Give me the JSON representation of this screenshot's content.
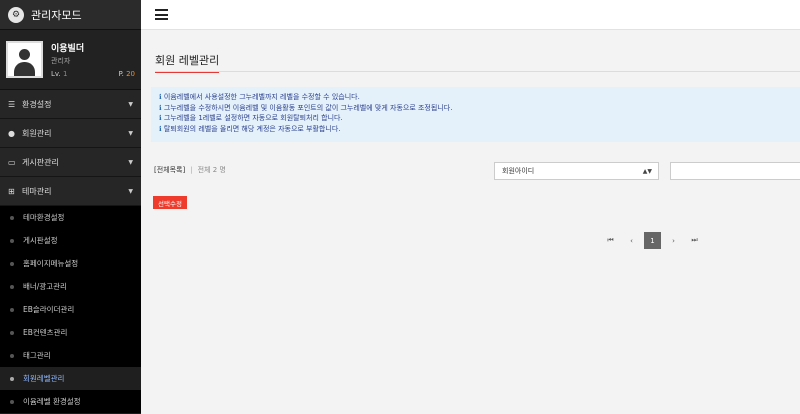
{
  "brand": {
    "title": "관리자모드"
  },
  "profile": {
    "name": "이용빌더",
    "role": "관리자",
    "level_label": "Lv.",
    "level_value": "1",
    "points_label": "P.",
    "points_value": "20"
  },
  "menu": [
    {
      "label": "환경설정",
      "icon": "sliders-icon"
    },
    {
      "label": "회원관리",
      "icon": "user-icon"
    },
    {
      "label": "게시판관리",
      "icon": "keyboard-icon"
    },
    {
      "label": "테마관리",
      "icon": "sitemap-icon"
    }
  ],
  "submenu": [
    {
      "label": "테마환경설정"
    },
    {
      "label": "게시판설정"
    },
    {
      "label": "홈페이지메뉴설정"
    },
    {
      "label": "배너/광고관리"
    },
    {
      "label": "EB슬라이더관리"
    },
    {
      "label": "EB컨텐츠관리"
    },
    {
      "label": "태그관리"
    },
    {
      "label": "회원레벨관리"
    },
    {
      "label": "이윰레벨 환경설정"
    }
  ],
  "page": {
    "title": "회원 레벨관리",
    "info": [
      "이윰레벨에서 사용설정한 그누레벨까지 레벨을 수정할 수 있습니다.",
      "그누레벨을 수정하시면 이윰레벨 및 이윰활동 포인트의 값이 그누레벨에 맞게 자동으로 조정됩니다.",
      "그누레벨을 1레벨로 설정하면 자동으로 회원탈퇴처리 합니다.",
      "탈퇴회원의 레벨을 올리면 해당 계정은 자동으로 부활합니다."
    ],
    "filter_all": "[전체목록]",
    "filter_sep": "|",
    "total_count": "전체 2 명",
    "search_select": "회원아이디",
    "search_value": "",
    "edit_button": "선택수정",
    "pagination": {
      "first": "⏮",
      "prev": "‹",
      "current": "1",
      "next": "›",
      "last": "⏭"
    }
  },
  "colors": {
    "accent": "#ef3b2c",
    "info_bg": "#e4f1fb",
    "sidebar_bg": "#1c1c1c"
  }
}
